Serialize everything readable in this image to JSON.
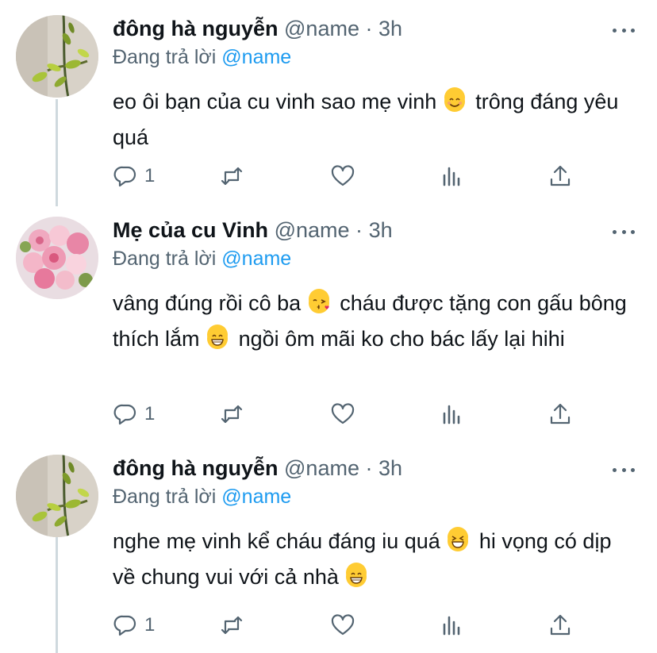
{
  "tweets": [
    {
      "name": "đông hà nguyễn",
      "handle": "@name",
      "dot": "·",
      "time": "3h",
      "reply_prefix": "Đang trả lời",
      "reply_mention": "@name",
      "avatar": "leaf-branch-icon",
      "text_parts": [
        "eo ôi bạn của cu vinh sao mẹ vinh",
        "trông đáng yêu quá"
      ],
      "emoji": [
        "smiling-face-icon"
      ],
      "reply_count": "1"
    },
    {
      "name": "Mẹ của cu Vinh",
      "handle": "@name",
      "dot": "·",
      "time": "3h",
      "reply_prefix": "Đang trả lời",
      "reply_mention": "@name",
      "avatar": "flower-bouquet-icon",
      "text_parts": [
        "vâng đúng rồi cô ba",
        "cháu được tặng con gấu bông thích lắm",
        "ngồi ôm mãi ko cho bác lấy lại hihi"
      ],
      "emoji": [
        "kissing-face-icon",
        "grinning-face-icon"
      ],
      "reply_count": "1"
    },
    {
      "name": "đông hà nguyễn",
      "handle": "@name",
      "dot": "·",
      "time": "3h",
      "reply_prefix": "Đang trả lời",
      "reply_mention": "@name",
      "avatar": "leaf-branch-icon",
      "text_parts": [
        "nghe mẹ vinh kể cháu đáng iu quá",
        "hi vọng có dịp về chung vui với cả nhà"
      ],
      "emoji": [
        "laughing-face-icon",
        "grinning-face-icon"
      ],
      "reply_count": "1"
    }
  ],
  "colors": {
    "secondary": "#536471",
    "link": "#1d9bf0",
    "thread_line": "#cfd9de"
  }
}
